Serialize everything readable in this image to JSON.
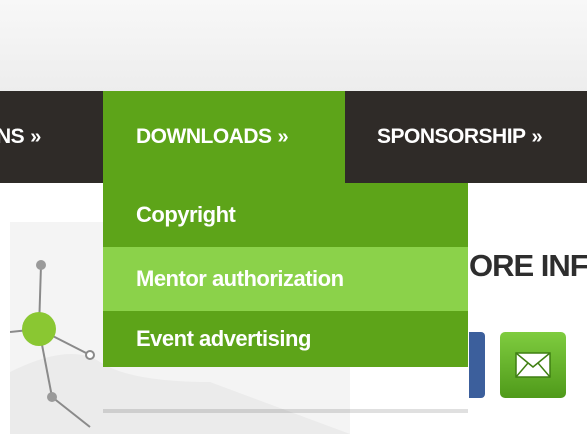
{
  "nav": {
    "items": [
      {
        "label": "NS",
        "arrow": "»"
      },
      {
        "label": "DOWNLOADS",
        "arrow": "»",
        "active": true
      },
      {
        "label": "SPONSORSHIP",
        "arrow": "»"
      }
    ]
  },
  "dropdown": {
    "items": [
      {
        "label": "Copyright"
      },
      {
        "label": "Mentor authorization",
        "highlighted": true
      },
      {
        "label": "Event advertising"
      }
    ]
  },
  "main": {
    "heading": "ORE INF"
  },
  "colors": {
    "nav_bg": "#2f2b28",
    "accent_green": "#5da419",
    "hover_green": "#8bd24a",
    "social_blue": "#3c5f9c"
  },
  "icons": [
    "mail-icon",
    "network-graphic"
  ]
}
